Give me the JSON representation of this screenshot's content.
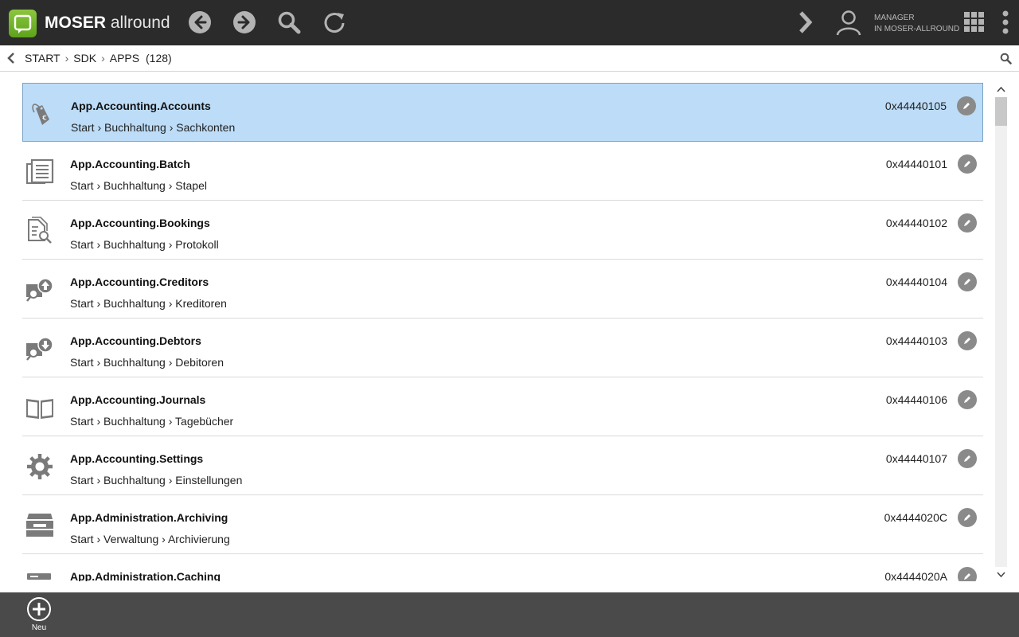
{
  "header": {
    "brand_bold": "MOSER",
    "brand_light": "allround",
    "user_role": "MANAGER",
    "user_org": "IN MOSER-ALLROUND"
  },
  "breadcrumb": {
    "items": [
      "START",
      "SDK",
      "APPS"
    ],
    "count": "(128)"
  },
  "apps": [
    {
      "title": "App.Accounting.Accounts",
      "path": "Start › Buchhaltung › Sachkonten",
      "code": "0x44440105",
      "icon": "price-tag-euro-icon",
      "selected": true
    },
    {
      "title": "App.Accounting.Batch",
      "path": "Start › Buchhaltung › Stapel",
      "code": "0x44440101",
      "icon": "document-stack-icon"
    },
    {
      "title": "App.Accounting.Bookings",
      "path": "Start › Buchhaltung › Protokoll",
      "code": "0x44440102",
      "icon": "document-search-icon"
    },
    {
      "title": "App.Accounting.Creditors",
      "path": "Start › Buchhaltung › Kreditoren",
      "code": "0x44440104",
      "icon": "person-search-upload-icon"
    },
    {
      "title": "App.Accounting.Debtors",
      "path": "Start › Buchhaltung › Debitoren",
      "code": "0x44440103",
      "icon": "person-search-download-icon"
    },
    {
      "title": "App.Accounting.Journals",
      "path": "Start › Buchhaltung › Tagebücher",
      "code": "0x44440106",
      "icon": "open-book-icon"
    },
    {
      "title": "App.Accounting.Settings",
      "path": "Start › Buchhaltung › Einstellungen",
      "code": "0x44440107",
      "icon": "gear-icon"
    },
    {
      "title": "App.Administration.Archiving",
      "path": "Start › Verwaltung › Archivierung",
      "code": "0x4444020C",
      "icon": "archive-box-icon"
    },
    {
      "title": "App.Administration.Caching",
      "path": "",
      "code": "0x4444020A",
      "icon": "server-icon"
    }
  ],
  "footer": {
    "new_label": "Neu"
  },
  "colors": {
    "topbar": "#2b2b2b",
    "selected_row": "#bcdcf7",
    "brand_green": "#6db22a",
    "bottombar": "#4a4a4a"
  }
}
